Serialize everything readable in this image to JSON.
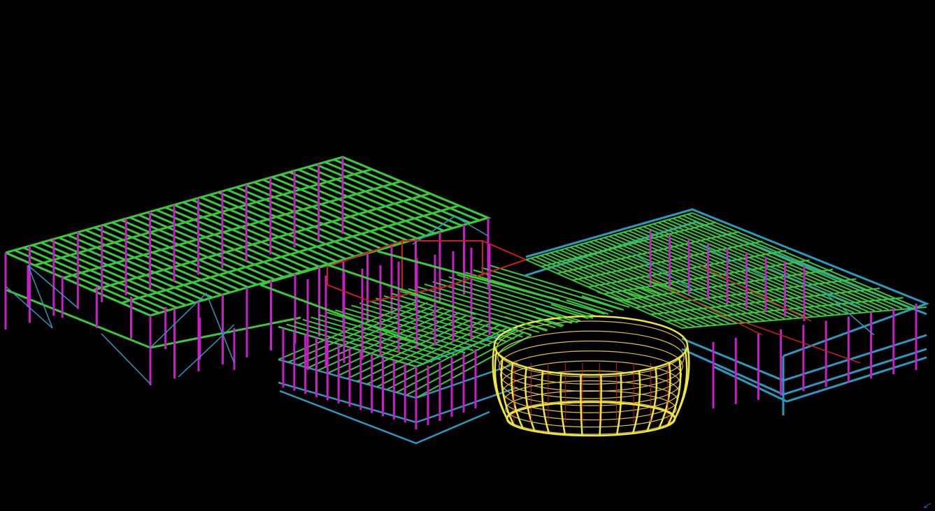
{
  "viewport": {
    "background": "#000000",
    "description_colors": {
      "beam": "#3cc83c",
      "column": "#c81ec8",
      "bracing": "#2a9ac0",
      "edge_beam": "#2a9ac0",
      "secondary_beam": "#c81e1e",
      "dome_rib": "#f0e640",
      "dome_ring": "#e0c040"
    },
    "icons": {
      "axis_indicator": "axis-triad-icon"
    }
  }
}
